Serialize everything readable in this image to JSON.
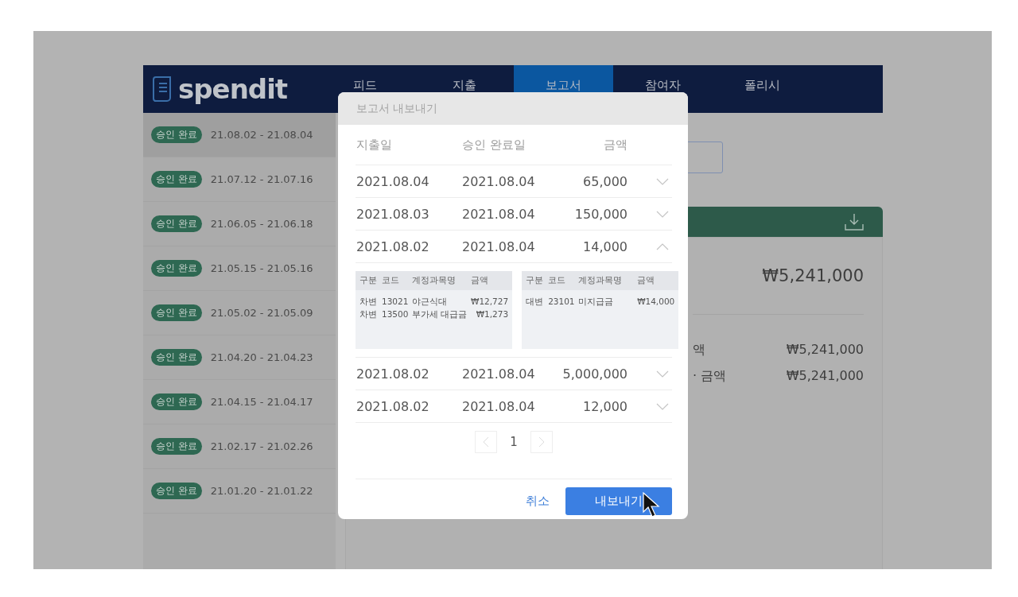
{
  "header": {
    "logo": "spendit",
    "tabs": [
      {
        "label": "피드",
        "selected": false
      },
      {
        "label": "지출",
        "selected": false
      },
      {
        "label": "보고서",
        "selected": true
      },
      {
        "label": "참여자",
        "selected": false
      },
      {
        "label": "폴리시",
        "selected": false
      }
    ]
  },
  "sidebar": {
    "items": [
      {
        "status": "승인 완료",
        "period": "21.08.02 - 21.08.04",
        "selected": true
      },
      {
        "status": "승인 완료",
        "period": "21.07.12 - 21.07.16",
        "selected": false
      },
      {
        "status": "승인 완료",
        "period": "21.06.05 - 21.06.18",
        "selected": false
      },
      {
        "status": "승인 완료",
        "period": "21.05.15 - 21.05.16",
        "selected": false
      },
      {
        "status": "승인 완료",
        "period": "21.05.02 - 21.05.09",
        "selected": false
      },
      {
        "status": "승인 완료",
        "period": "21.04.20 - 21.04.23",
        "selected": false
      },
      {
        "status": "승인 완료",
        "period": "21.04.15 - 21.04.17",
        "selected": false
      },
      {
        "status": "승인 완료",
        "period": "21.02.17 - 21.02.26",
        "selected": false
      },
      {
        "status": "승인 완료",
        "period": "21.01.20 - 21.01.22",
        "selected": false
      }
    ]
  },
  "report_card": {
    "total": "₩5,241,000",
    "rows": [
      {
        "label": "액",
        "value": "₩5,241,000"
      },
      {
        "label": "· 금액",
        "value": "₩5,241,000"
      }
    ]
  },
  "modal": {
    "title": "보고서 내보내기",
    "columns": [
      "지출일",
      "승인 완료일",
      "금액"
    ],
    "rows": [
      {
        "spent": "2021.08.04",
        "approved": "2021.08.04",
        "amount": "65,000",
        "expanded": false
      },
      {
        "spent": "2021.08.03",
        "approved": "2021.08.04",
        "amount": "150,000",
        "expanded": false
      },
      {
        "spent": "2021.08.02",
        "approved": "2021.08.04",
        "amount": "14,000",
        "expanded": true,
        "entries": [
          {
            "columns": [
              "구분",
              "코드",
              "계정과목명",
              "금액"
            ],
            "rows": [
              [
                "차변",
                "13021",
                "야근식대",
                "₩12,727"
              ],
              [
                "차변",
                "13500",
                "부가세 대급금",
                "₩1,273"
              ]
            ]
          },
          {
            "columns": [
              "구분",
              "코드",
              "계정과목명",
              "금액"
            ],
            "rows": [
              [
                "대변",
                "23101",
                "미지급금",
                "₩14,000"
              ]
            ]
          }
        ]
      },
      {
        "spent": "2021.08.02",
        "approved": "2021.08.04",
        "amount": "5,000,000",
        "expanded": false
      },
      {
        "spent": "2021.08.02",
        "approved": "2021.08.04",
        "amount": "12,000",
        "expanded": false
      }
    ],
    "page": "1",
    "cancel": "취소",
    "confirm": "내보내기"
  }
}
